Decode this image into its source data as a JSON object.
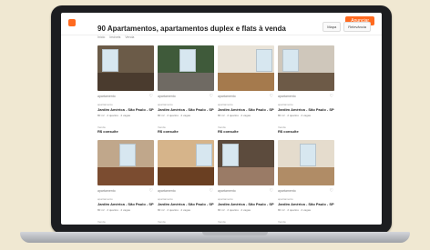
{
  "page": {
    "title": "90 Apartamentos, apartamentos duplex e flats à venda",
    "breadcrumb": [
      "Início",
      "Imóveis",
      "Venda"
    ],
    "cta_label": "Anunciar",
    "filters": [
      "Mapa",
      "Relevância"
    ]
  },
  "cards": [
    {
      "type": "apartamento",
      "sub": "apartamento",
      "name": "Jardim América - São Paulo - SP",
      "specs": "80 m² · 2 quartos · 2 vagas",
      "price_label": "Venda",
      "price": "R$ consulte",
      "colors": {
        "wall": "#6b5b48",
        "floor": "#4a3b2e"
      }
    },
    {
      "type": "apartamento",
      "sub": "apartamento",
      "name": "Jardim América - São Paulo - SP",
      "specs": "80 m² · 2 quartos · 2 vagas",
      "price_label": "Venda",
      "price": "R$ consulte",
      "colors": {
        "wall": "#3f5a3a",
        "floor": "#6f6a63"
      }
    },
    {
      "type": "apartamento",
      "sub": "apartamento",
      "name": "Jardim América - São Paulo - SP",
      "specs": "80 m² · 2 quartos · 2 vagas",
      "price_label": "Venda",
      "price": "R$ consulte",
      "colors": {
        "wall": "#e9e3d8",
        "floor": "#a57a4d"
      }
    },
    {
      "type": "apartamento",
      "sub": "apartamento",
      "name": "Jardim América - São Paulo - SP",
      "specs": "80 m² · 2 quartos · 2 vagas",
      "price_label": "Venda",
      "price": "R$ consulte",
      "colors": {
        "wall": "#cfc7bb",
        "floor": "#6d5a47"
      }
    },
    {
      "type": "apartamento",
      "sub": "apartamento",
      "name": "Jardim América - São Paulo - SP",
      "specs": "80 m² · 2 quartos · 2 vagas",
      "price_label": "Venda",
      "price": "R$ consulte",
      "colors": {
        "wall": "#c0a78b",
        "floor": "#7b4c30"
      }
    },
    {
      "type": "apartamento",
      "sub": "apartamento",
      "name": "Jardim América - São Paulo - SP",
      "specs": "80 m² · 2 quartos · 2 vagas",
      "price_label": "Venda",
      "price": "R$ consulte",
      "colors": {
        "wall": "#d6b48a",
        "floor": "#6a3f22"
      }
    },
    {
      "type": "apartamento",
      "sub": "apartamento",
      "name": "Jardim América - São Paulo - SP",
      "specs": "80 m² · 2 quartos · 2 vagas",
      "price_label": "Venda",
      "price": "R$ consulte",
      "colors": {
        "wall": "#5c4b3d",
        "floor": "#9a7b66"
      }
    },
    {
      "type": "apartamento",
      "sub": "apartamento",
      "name": "Jardim América - São Paulo - SP",
      "specs": "80 m² · 2 quartos · 2 vagas",
      "price_label": "Venda",
      "price": "R$ consulte",
      "colors": {
        "wall": "#e5dccd",
        "floor": "#b08c66"
      }
    }
  ]
}
